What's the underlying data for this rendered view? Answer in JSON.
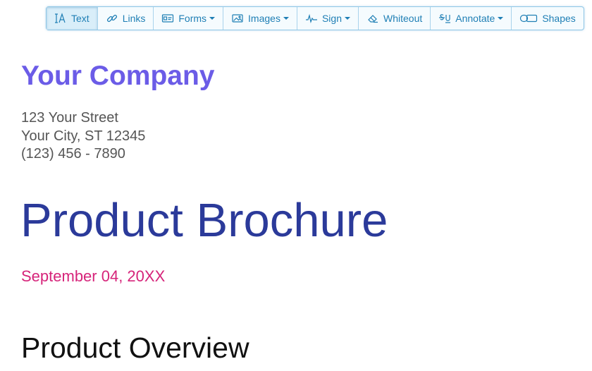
{
  "toolbar": {
    "items": [
      {
        "label": "Text",
        "icon": "text-cursor-icon",
        "active": true
      },
      {
        "label": "Links",
        "icon": "link-icon"
      },
      {
        "label": "Forms",
        "icon": "form-icon",
        "dropdown": true
      },
      {
        "label": "Images",
        "icon": "image-icon",
        "dropdown": true
      },
      {
        "label": "Sign",
        "icon": "signature-icon",
        "dropdown": true
      },
      {
        "label": "Whiteout",
        "icon": "eraser-icon"
      },
      {
        "label": "Annotate",
        "icon": "strikethrough-underline-icon",
        "dropdown": true
      },
      {
        "label": "Shapes",
        "icon": "shapes-icon"
      }
    ],
    "colors": {
      "text": "#1f7fb5",
      "border": "#8fc7e6",
      "active_bg": "#d9eef9"
    }
  },
  "document": {
    "company_name": "Your Company",
    "address_line1": "123 Your Street",
    "address_line2": "Your City, ST 12345",
    "phone": "(123) 456 - 7890",
    "title": "Product Brochure",
    "date": "September 04, 20XX",
    "section_heading": "Product Overview",
    "colors": {
      "company": "#6b5ce7",
      "title": "#2b3a9a",
      "date": "#d6247a",
      "address": "#555555"
    }
  }
}
